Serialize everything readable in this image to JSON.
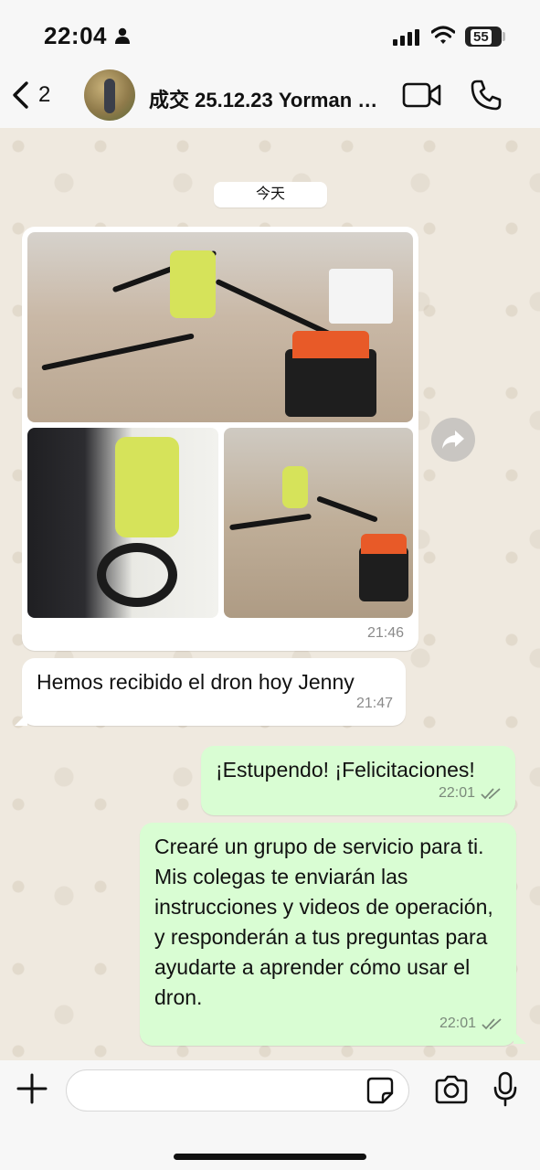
{
  "status_bar": {
    "time": "22:04",
    "battery": "55"
  },
  "header": {
    "back_count": "2",
    "contact_name": "成交 25.12.23 Yorman H...",
    "video_icon": "video-camera-icon",
    "call_icon": "phone-icon"
  },
  "chat": {
    "date_chip": "今天",
    "album": {
      "time": "21:46",
      "photo_count": 3
    },
    "messages": [
      {
        "direction": "in",
        "text": "Hemos recibido el dron hoy Jenny",
        "time": "21:47"
      },
      {
        "direction": "out",
        "text": "¡Estupendo! ¡Felicitaciones!",
        "time": "22:01",
        "status": "read"
      },
      {
        "direction": "out",
        "text": "Crearé un grupo de servicio para ti. Mis colegas te enviarán las instrucciones y videos de operación, y responderán a tus preguntas para ayudarte a aprender cómo usar el dron.",
        "time": "22:01",
        "status": "read"
      }
    ]
  },
  "input_bar": {
    "placeholder": "",
    "value": ""
  },
  "colors": {
    "outgoing_bubble": "#d9fdd3",
    "incoming_bubble": "#ffffff",
    "wallpaper": "#efe9df",
    "read_ticks": "#7b8a7b"
  }
}
